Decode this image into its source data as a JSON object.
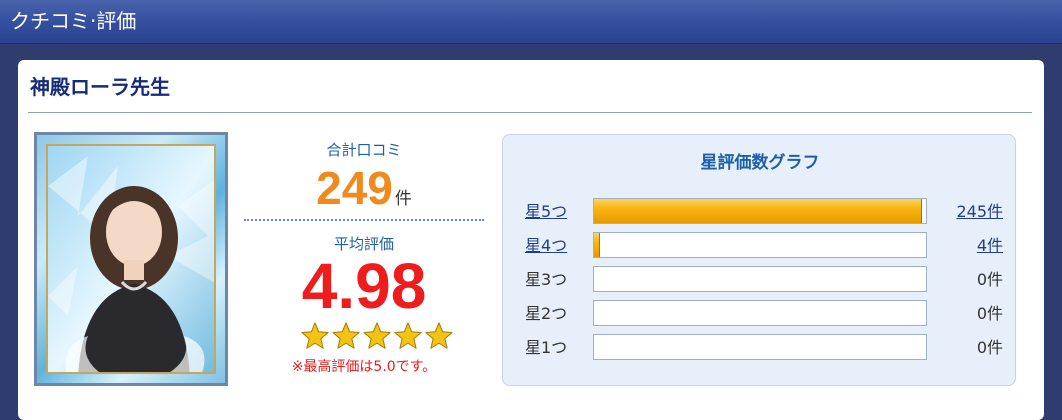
{
  "header": {
    "title": "クチコミ·評価"
  },
  "teacher": {
    "name": "神殿ローラ先生"
  },
  "summary": {
    "total_label": "合計口コミ",
    "total_count": "249",
    "total_unit": "件",
    "avg_label": "平均評価",
    "avg_score": "4.98",
    "stars_filled": 5,
    "stars_max": 5,
    "note": "※最高評価は5.0です。"
  },
  "graph": {
    "title": "星評価数グラフ",
    "rows": [
      {
        "label": "星5つ",
        "count": "245件",
        "value": 245,
        "linked": true
      },
      {
        "label": "星4つ",
        "count": "4件",
        "value": 4,
        "linked": true
      },
      {
        "label": "星3つ",
        "count": "0件",
        "value": 0,
        "linked": false
      },
      {
        "label": "星2つ",
        "count": "0件",
        "value": 0,
        "linked": false
      },
      {
        "label": "星1つ",
        "count": "0件",
        "value": 0,
        "linked": false
      }
    ],
    "max_value": 249
  },
  "colors": {
    "header_bg": "#3550a0",
    "accent_blue": "#1d5fa8",
    "total_orange": "#f08a1e",
    "score_red": "#ee1c1c",
    "star_gold": "#f3c316",
    "bar_gold": "#f7b210"
  },
  "icons": {
    "star": "star-icon",
    "photo": "teacher-portrait"
  }
}
